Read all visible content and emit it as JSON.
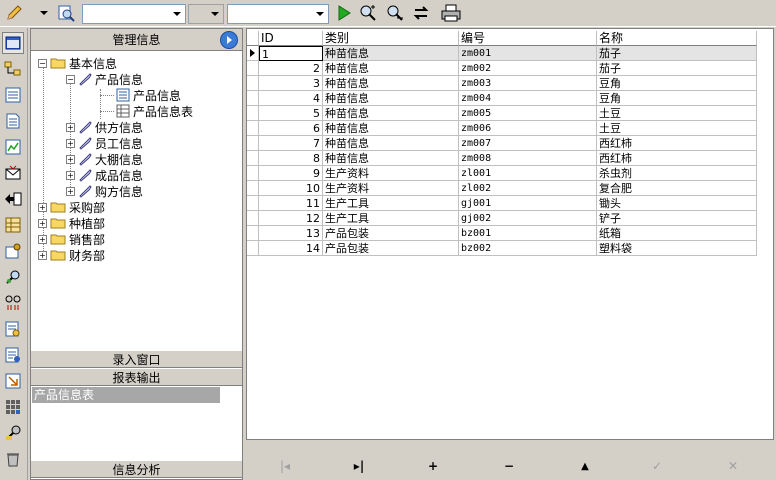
{
  "toolbar": {
    "combos": [
      {
        "value": ""
      },
      {
        "value": ""
      },
      {
        "value": ""
      }
    ]
  },
  "left_panel": {
    "title": "管理信息",
    "tree": {
      "root": "基本信息",
      "product_info": "产品信息",
      "product_info_child1": "产品信息",
      "product_info_child2": "产品信息表",
      "supplier": "供方信息",
      "employee": "员工信息",
      "greenhouse": "大棚信息",
      "finished": "成品信息",
      "buyer": "购方信息",
      "dept_purchase": "采购部",
      "dept_plant": "种植部",
      "dept_sales": "销售部",
      "dept_finance": "财务部"
    },
    "sections": {
      "entry": "录入窗口",
      "report": "报表输出",
      "report_item": "产品信息表",
      "analysis": "信息分析"
    }
  },
  "grid": {
    "columns": [
      "ID",
      "类别",
      "编号",
      "名称"
    ],
    "rows": [
      {
        "id": "1",
        "category": "种苗信息",
        "code": "zm001",
        "name": "茄子"
      },
      {
        "id": "2",
        "category": "种苗信息",
        "code": "zm002",
        "name": "茄子"
      },
      {
        "id": "3",
        "category": "种苗信息",
        "code": "zm003",
        "name": "豆角"
      },
      {
        "id": "4",
        "category": "种苗信息",
        "code": "zm004",
        "name": "豆角"
      },
      {
        "id": "5",
        "category": "种苗信息",
        "code": "zm005",
        "name": "土豆"
      },
      {
        "id": "6",
        "category": "种苗信息",
        "code": "zm006",
        "name": "土豆"
      },
      {
        "id": "7",
        "category": "种苗信息",
        "code": "zm007",
        "name": "西红柿"
      },
      {
        "id": "8",
        "category": "种苗信息",
        "code": "zm008",
        "name": "西红柿"
      },
      {
        "id": "9",
        "category": "生产资料",
        "code": "zl001",
        "name": "杀虫剂"
      },
      {
        "id": "10",
        "category": "生产资料",
        "code": "zl002",
        "name": "复合肥"
      },
      {
        "id": "11",
        "category": "生产工具",
        "code": "gj001",
        "name": "锄头"
      },
      {
        "id": "12",
        "category": "生产工具",
        "code": "gj002",
        "name": "铲子"
      },
      {
        "id": "13",
        "category": "产品包装",
        "code": "bz001",
        "name": "纸箱"
      },
      {
        "id": "14",
        "category": "产品包装",
        "code": "bz002",
        "name": "塑料袋"
      }
    ]
  },
  "navigator": {
    "first": "|◂",
    "last": "▸|",
    "insert": "+",
    "delete": "−",
    "edit": "▲",
    "post": "✓",
    "cancel": "✕"
  },
  "colors": {
    "face": "#d4d0c8",
    "selected_item": "#a7a7a7",
    "accent_green": "#22aa22",
    "go_button": "#3a7bd5"
  }
}
